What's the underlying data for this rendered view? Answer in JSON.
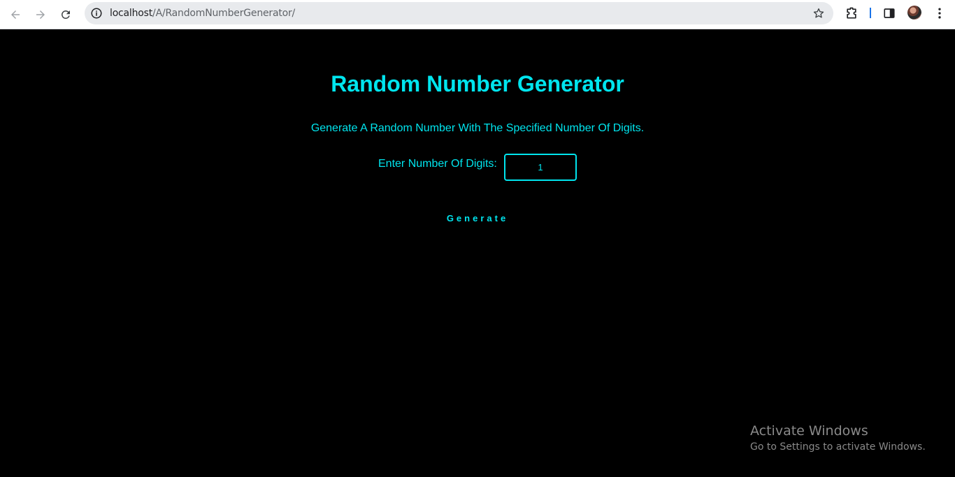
{
  "browser": {
    "url_host": "localhost",
    "url_path": "/A/RandomNumberGenerator/",
    "icons": {
      "back": "back-arrow-icon",
      "forward": "forward-arrow-icon",
      "reload": "reload-icon",
      "site_info": "info-icon",
      "bookmark": "star-icon",
      "extensions": "puzzle-icon",
      "side_panel": "side-panel-icon",
      "profile": "avatar",
      "menu": "kebab-menu-icon"
    }
  },
  "app": {
    "title": "Random Number Generator",
    "description": "Generate A Random Number With The Specified Number Of Digits.",
    "digits_label": "Enter Number Of Digits:",
    "digits_value": "1",
    "generate_label": "Generate"
  },
  "watermark": {
    "title": "Activate Windows",
    "subtitle": "Go to Settings to activate Windows."
  },
  "colors": {
    "accent": "#00e5ee",
    "background": "#000000"
  }
}
